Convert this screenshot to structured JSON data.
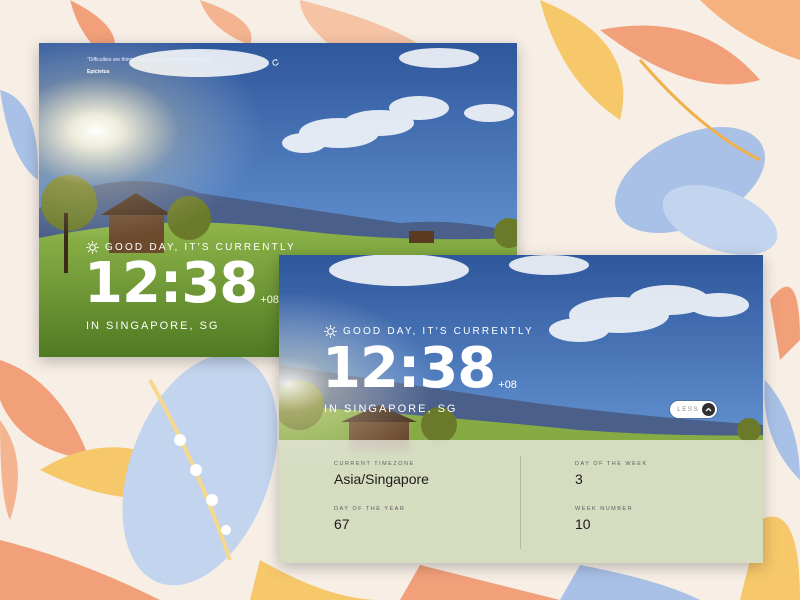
{
  "back_screen": {
    "quote": "\"Difficulties are things that show a person what they are.\"",
    "quote_author": "Epictetus",
    "greeting": "GOOD DAY, IT'S CURRENTLY",
    "time": "12:38",
    "timezone_offset": "+08",
    "location": "IN SINGAPORE, SG"
  },
  "front_screen": {
    "greeting": "GOOD DAY, IT'S CURRENTLY",
    "time": "12:38",
    "timezone_offset": "+08",
    "location": "IN SINGAPORE, SG",
    "toggle_label": "LESS",
    "details": {
      "current_timezone": {
        "label": "CURRENT TIMEZONE",
        "value": "Asia/Singapore"
      },
      "day_of_week": {
        "label": "DAY OF THE WEEK",
        "value": "3"
      },
      "day_of_year": {
        "label": "DAY OF THE YEAR",
        "value": "67"
      },
      "week_number": {
        "label": "WEEK NUMBER",
        "value": "10"
      }
    }
  },
  "icons": {
    "refresh": "refresh-icon",
    "sun": "sun-icon",
    "toggle": "chevron-up-icon"
  },
  "colors": {
    "sky_top": "#3a63a6",
    "sky_bottom": "#7aa4cf",
    "grass": "#7da63a",
    "details_bg": "#e8e8de",
    "button_dark": "#303030"
  }
}
